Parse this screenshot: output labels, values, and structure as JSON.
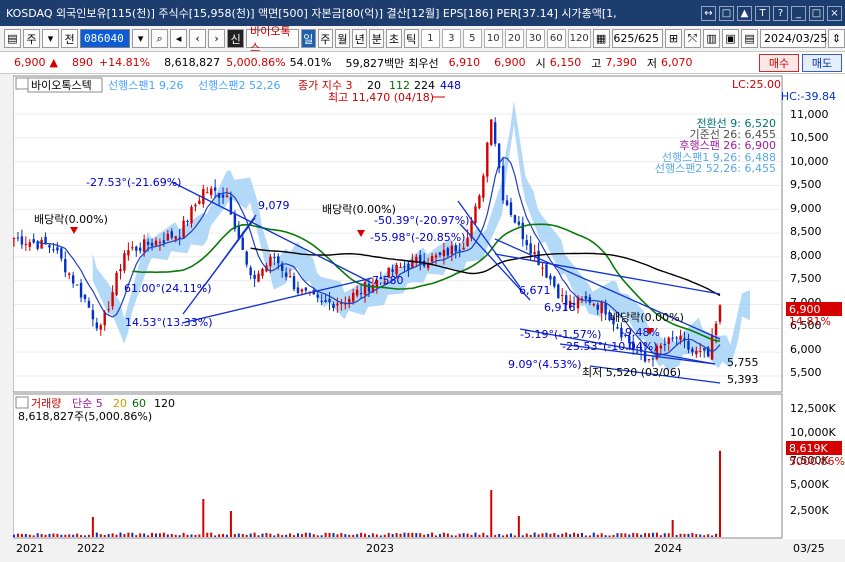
{
  "window": {
    "title": "KOSDAQ 외국인보유[115(천)] 주식수[15,958(천)] 액면[500] 자본금[80(억)] 결산[12월] EPS[186] PER[37.14] 시가총액[1,",
    "controls": [
      "↔",
      "□",
      "▲",
      "T",
      "?",
      "_",
      "□",
      "×"
    ]
  },
  "toolbar": {
    "market_type": "주",
    "prev_label": "전",
    "code": "086040",
    "stock_name": "바이오톡스",
    "info_label": "신",
    "periods": [
      "일",
      "주",
      "월",
      "년",
      "분",
      "초",
      "틱"
    ],
    "active_period": "일",
    "intervals": [
      "1",
      "3",
      "5",
      "10",
      "20",
      "30",
      "60",
      "120"
    ],
    "count": "625/625",
    "date": "2024/03/25"
  },
  "quote": {
    "price": "6,900",
    "change": "890",
    "change_pct": "+14.81%",
    "volume": "8,618,827",
    "volume_ratio": "5,000.86%",
    "turnover": "54.01%",
    "amount": "59,827백만",
    "best_label": "최우선",
    "ask": "6,910",
    "bid": "6,900",
    "open_label": "시",
    "open": "6,150",
    "high_label": "고",
    "high": "7,390",
    "low_label": "저",
    "low": "6,070",
    "buy_label": "매수",
    "sell_label": "매도"
  },
  "price_panel": {
    "name_tag": "바이오톡스텍",
    "legend": [
      {
        "text": "선행스팬1 9,26",
        "color": "#4aa3ff"
      },
      {
        "text": "선행스팬2 52,26",
        "color": "#4aa3ff"
      },
      {
        "text": "종가 지수 3",
        "color": "#cc0000"
      },
      {
        "text": "20",
        "color": "#000000"
      },
      {
        "text": "112",
        "color": "#007000"
      },
      {
        "text": "224",
        "color": "#000000"
      },
      {
        "text": "448",
        "color": "#0000cc"
      }
    ],
    "high_note": "최고 11,470 (04/18)",
    "low_note": "최저 5,520 (03/06)",
    "lc": "LC:25.00",
    "hc": "HC:-39.84",
    "ichimoku": [
      {
        "text": "전환선 9: 6,520",
        "color": "#007070"
      },
      {
        "text": "기준선 26: 6,455",
        "color": "#505050"
      },
      {
        "text": "후행스팬 26: 6,900",
        "color": "#9c1c9c"
      },
      {
        "text": "선행스팬1 9,26: 6,488",
        "color": "#5aa8e8"
      },
      {
        "text": "선행스팬2 52,26: 6,455",
        "color": "#5aa8e8"
      }
    ],
    "yaxis": [
      "11,000",
      "10,500",
      "10,000",
      "9,500",
      "9,000",
      "8,500",
      "8,000",
      "7,500",
      "7,000",
      "6,500",
      "6,000",
      "5,500"
    ],
    "current_price_tag": "6,900",
    "current_pct_tag": "14.81%",
    "annotations": [
      {
        "text": "-27.53°(-21.69%)",
        "color": "#0000cc"
      },
      {
        "text": "9,079",
        "color": "#0000cc"
      },
      {
        "text": "배당락(0.00%)",
        "color": "#000000"
      },
      {
        "text": "배당락(0.00%)",
        "color": "#000000"
      },
      {
        "text": "-50.39°(-20.97%)",
        "color": "#0000cc"
      },
      {
        "text": "-55.98°(-20.85%)",
        "color": "#0000cc"
      },
      {
        "text": "61.00°(24.11%)",
        "color": "#0000cc"
      },
      {
        "text": "14.53°(13.33%)",
        "color": "#0000cc"
      },
      {
        "text": "7,580",
        "color": "#0000cc"
      },
      {
        "text": "6,671",
        "color": "#0000cc"
      },
      {
        "text": "6,916",
        "color": "#0000cc"
      },
      {
        "text": "-5.19°(-1.57%)",
        "color": "#0000cc"
      },
      {
        "text": "-9.48%",
        "color": "#0000cc"
      },
      {
        "text": "-25.53°(-10.04%)",
        "color": "#0000cc"
      },
      {
        "text": "9.09°(4.53%)",
        "color": "#0000cc"
      },
      {
        "text": "배당락(0.00%)",
        "color": "#000000"
      },
      {
        "text": "5,755",
        "color": "#000000"
      },
      {
        "text": "5,393",
        "color": "#000000"
      }
    ]
  },
  "volume_panel": {
    "legend": [
      {
        "text": "거래량",
        "color": "#cc0000"
      },
      {
        "text": "단순 5",
        "color": "#9c1c9c"
      },
      {
        "text": "20",
        "color": "#c8a000"
      },
      {
        "text": "60",
        "color": "#007000"
      },
      {
        "text": "120",
        "color": "#000000"
      }
    ],
    "value_note": "8,618,827주(5,000.86%)",
    "yaxis": [
      "12,500K",
      "10,000K",
      "7,500K",
      "5,000K",
      "2,500K"
    ],
    "current_tag": "8,619K",
    "current_pct_tag": "5000.86%"
  },
  "xaxis": {
    "labels": [
      "2021",
      "2022",
      "2023",
      "2024"
    ],
    "right_label": "03/25"
  },
  "colors": {
    "up": "#d40000",
    "down": "#0030c8",
    "cloud": "#9fd0f5",
    "ma20": "#1f3fbf",
    "ma112": "#0a7a0a",
    "ma224": "#000000",
    "trendline": "#1030d0"
  }
}
